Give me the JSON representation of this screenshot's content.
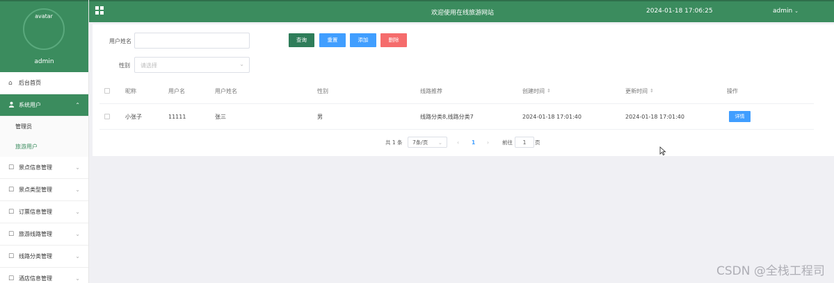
{
  "sidebar": {
    "avatar_alt": "avatar",
    "username": "admin",
    "items": [
      {
        "label": "后台首页",
        "icon": "home-icon"
      },
      {
        "label": "系统用户",
        "icon": "user-icon",
        "active": true,
        "children": [
          {
            "label": "管理员"
          },
          {
            "label": "旅游用户",
            "current": true
          }
        ]
      },
      {
        "label": "景点信息管理",
        "icon": "doc-icon"
      },
      {
        "label": "景点类型管理",
        "icon": "doc-icon"
      },
      {
        "label": "订票信息管理",
        "icon": "doc-icon"
      },
      {
        "label": "旅游线路管理",
        "icon": "doc-icon"
      },
      {
        "label": "线路分类管理",
        "icon": "doc-icon"
      },
      {
        "label": "酒店信息管理",
        "icon": "doc-icon"
      }
    ]
  },
  "topbar": {
    "title": "欢迎使用在线旅游网站",
    "datetime": "2024-01-18 17:06:25",
    "user": "admin"
  },
  "filters": {
    "name_label": "用户姓名",
    "name_value": "",
    "gender_label": "性别",
    "gender_placeholder": "请选择"
  },
  "buttons": {
    "search": "查询",
    "reset": "重置",
    "add": "添加",
    "delete": "删除"
  },
  "table": {
    "headers": [
      "昵称",
      "用户名",
      "用户姓名",
      "性别",
      "线路推荐",
      "创建时间",
      "更新时间",
      "操作"
    ],
    "rows": [
      {
        "nickname": "小张子",
        "username": "11111",
        "fullname": "张三",
        "gender": "男",
        "route": "线路分类8,线路分类7",
        "created": "2024-01-18 17:01:40",
        "updated": "2024-01-18 17:01:40",
        "action": "详情"
      }
    ]
  },
  "pagination": {
    "total": "共 1 条",
    "page_size": "7条/页",
    "current_page": "1",
    "goto_label": "前往",
    "goto_value": "1",
    "page_unit": "页"
  },
  "watermark": "CSDN @全栈工程司",
  "colors": {
    "brand_green": "#3b8c5e",
    "primary_blue": "#409eff",
    "danger_red": "#f56c6c"
  }
}
